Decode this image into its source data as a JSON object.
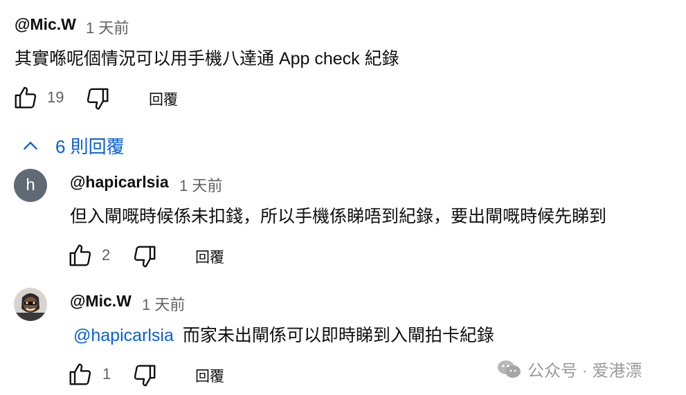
{
  "comment": {
    "handle": "@Mic.W",
    "time": "1 天前",
    "text": "其實喺呢個情況可以用手機八達通 App check 紀錄",
    "likes": "19",
    "reply_label": "回覆"
  },
  "replies_toggle": {
    "label": "6 則回覆"
  },
  "replies": [
    {
      "avatar_letter": "h",
      "handle": "@hapicarlsia",
      "time": "1 天前",
      "text": "但入閘嘅時候係未扣錢，所以手機係睇唔到紀錄，要出閘嘅時候先睇到",
      "likes": "2",
      "reply_label": "回覆"
    },
    {
      "handle": "@Mic.W",
      "time": "1 天前",
      "mention": "@hapicarlsia",
      "text": "而家未出閘係可以即時睇到入閘拍卡紀錄",
      "likes": "1",
      "reply_label": "回覆"
    }
  ],
  "watermark": {
    "text": "公众号 · 爱港漂"
  },
  "colors": {
    "mention": "#065fd4",
    "secondary_text": "#606060",
    "avatar_h": "#5f6a74"
  }
}
